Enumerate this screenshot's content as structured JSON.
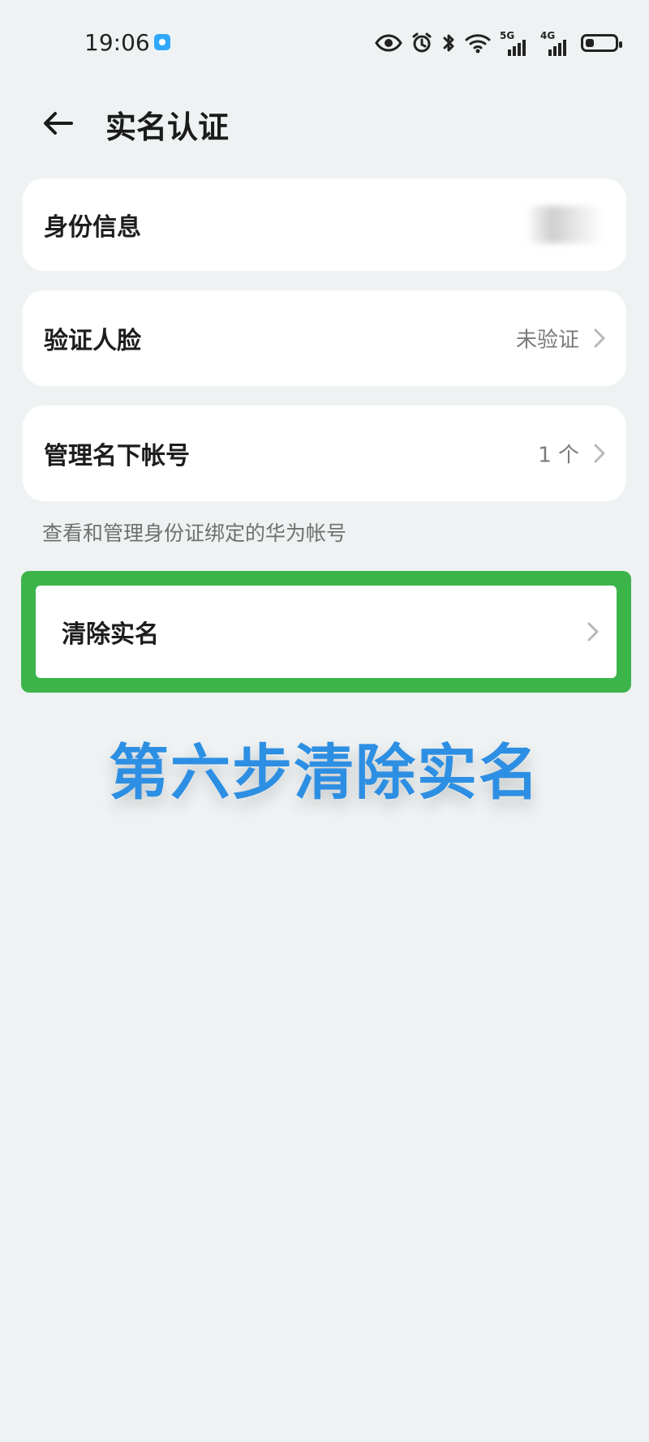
{
  "status_bar": {
    "time": "19:06",
    "net_5g": "5G",
    "net_4g": "4G",
    "icons": [
      "app-icon",
      "eye-icon",
      "alarm-icon",
      "bluetooth-icon",
      "wifi-icon",
      "signal-5g-icon",
      "signal-4g-icon",
      "battery-icon"
    ]
  },
  "header": {
    "title": "实名认证",
    "back_icon": "arrow-left-icon"
  },
  "cards": [
    {
      "label": "身份信息",
      "value": ""
    },
    {
      "label": "验证人脸",
      "value": "未验证"
    },
    {
      "label": "管理名下帐号",
      "value": "1 个"
    }
  ],
  "hint": "查看和管理身份证绑定的华为帐号",
  "highlight": {
    "label": "清除实名",
    "color": "#3cb44a"
  },
  "caption": {
    "text": "第六步清除实名",
    "color": "#2d8fe3"
  }
}
